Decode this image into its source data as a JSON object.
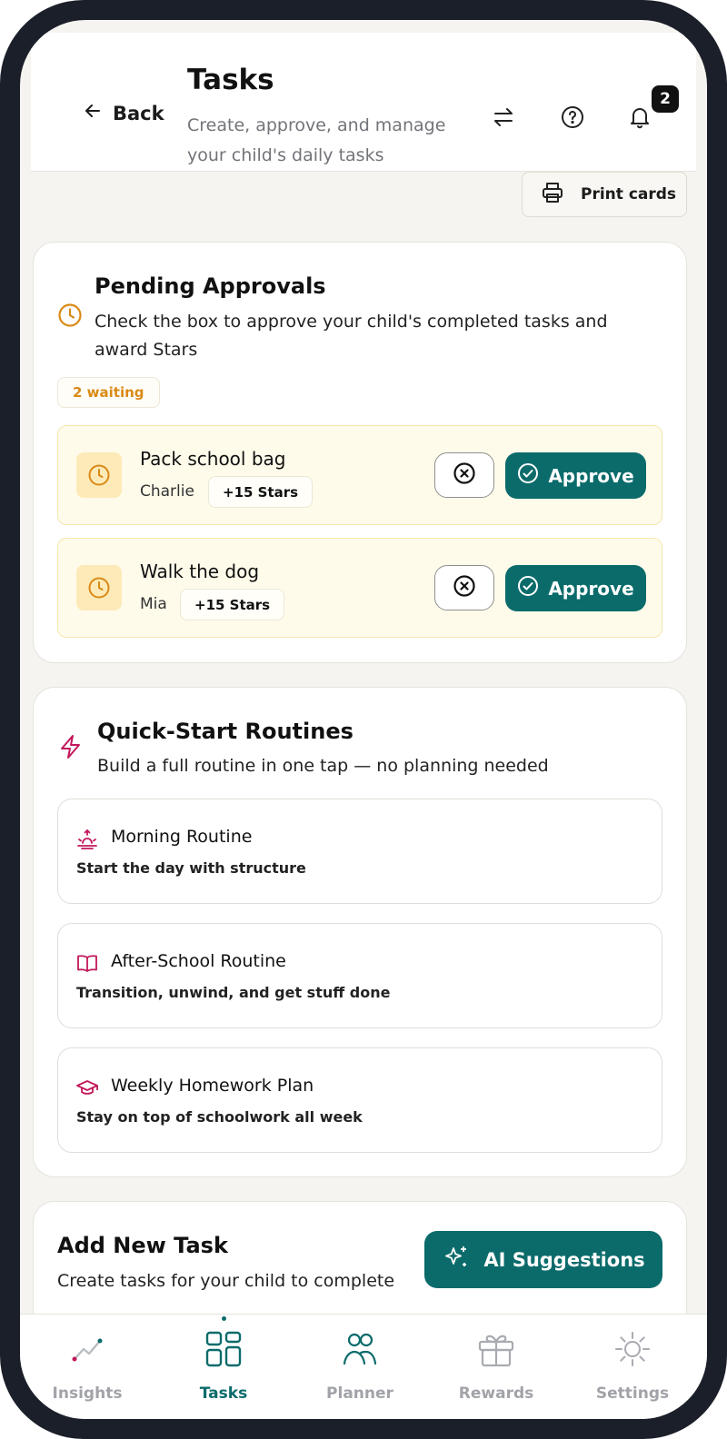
{
  "header": {
    "back_label": "Back",
    "title": "Tasks",
    "subtitle": "Create, approve, and manage your child's daily tasks",
    "notification_count": "2"
  },
  "toolbar": {
    "print_label": "Print cards"
  },
  "pending": {
    "title": "Pending Approvals",
    "subtitle": "Check the box to approve your child's completed tasks and award Stars",
    "waiting_badge": "2 waiting",
    "tasks": [
      {
        "name": "Pack school bag",
        "child": "Charlie",
        "stars": "+15 Stars",
        "approve_label": "Approve"
      },
      {
        "name": "Walk the dog",
        "child": "Mia",
        "stars": "+15 Stars",
        "approve_label": "Approve"
      }
    ]
  },
  "routines": {
    "title": "Quick-Start Routines",
    "subtitle": "Build a full routine in one tap — no planning needed",
    "items": [
      {
        "name": "Morning Routine",
        "desc": "Start the day with structure",
        "icon": "sunrise-icon"
      },
      {
        "name": "After-School Routine",
        "desc": "Transition, unwind, and get stuff done",
        "icon": "book-icon"
      },
      {
        "name": "Weekly Homework Plan",
        "desc": "Stay on top of schoolwork all week",
        "icon": "graduation-cap-icon"
      }
    ]
  },
  "add_task": {
    "title": "Add New Task",
    "subtitle": "Create tasks for your child to complete",
    "ai_label": "AI Suggestions"
  },
  "nav": {
    "items": [
      {
        "label": "Insights"
      },
      {
        "label": "Tasks"
      },
      {
        "label": "Planner"
      },
      {
        "label": "Rewards"
      },
      {
        "label": "Settings"
      }
    ]
  },
  "colors": {
    "accent": "#0b6b6b",
    "pending_bg": "#fffbea",
    "warning": "#d98a16",
    "routine_icon": "#c2185b"
  }
}
